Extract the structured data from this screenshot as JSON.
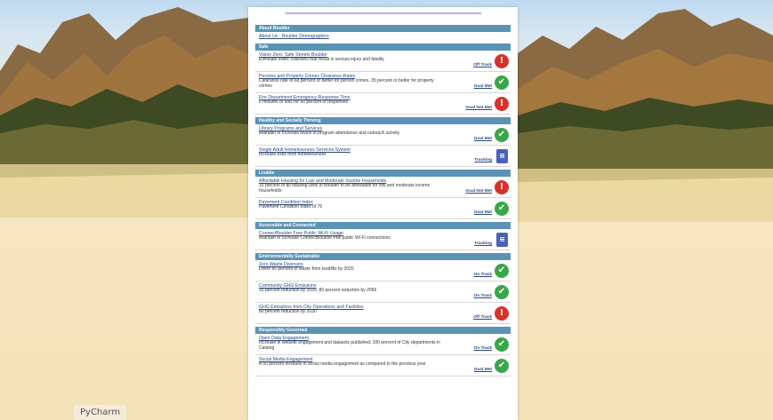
{
  "taskbar": {
    "app_label": "PyCharm"
  },
  "colors": {
    "section_header": "#5b93b6",
    "on_track": "#3aa64a",
    "off_track": "#d7322a",
    "tracking": "#4863b6"
  },
  "about": {
    "header": "About Boulder",
    "item_title": "About Us - Boulder Demographics"
  },
  "sections": [
    {
      "header": "Safe",
      "items": [
        {
          "title": "Vision Zero: Safe Streets Boulder",
          "desc": "Eliminate traffic collisions that result in serious injury and fatality",
          "status": "Off Track",
          "icon": "alert-icon"
        },
        {
          "title": "Persons and Property Crimes Clearance Rates",
          "desc": "Clearance rate of 68 percent or better for person crimes, 35 percent or better for property crimes",
          "status": "Goal Met",
          "icon": "check-icon"
        },
        {
          "title": "Fire Department Emergency Response Time",
          "desc": "6 minutes or less for 90 percent of responses",
          "status": "Goal Not Met",
          "icon": "alert-icon"
        }
      ]
    },
    {
      "header": "Healthy and Socially Thriving",
      "items": [
        {
          "title": "Library Programs and Services",
          "desc": "Maintain or increase levels of program attendance and outreach activity",
          "status": "Goal Met",
          "icon": "check-icon"
        },
        {
          "title": "Single Adult Homelessness Services System",
          "desc": "Increase exits from homelessness",
          "status": "Tracking",
          "icon": "clipboard-icon"
        }
      ]
    },
    {
      "header": "Livable",
      "items": [
        {
          "title": "Affordable Housing for Low and Moderate Income Households",
          "desc": "15 percent of all housing units in Boulder to be affordable for low and moderate income households",
          "status": "Goal Not Met",
          "icon": "alert-icon"
        },
        {
          "title": "Pavement Condition Index",
          "desc": "Pavement Condition Index of 75",
          "status": "Goal Met",
          "icon": "check-icon"
        }
      ]
    },
    {
      "header": "Accessible and Connected",
      "items": [
        {
          "title": "ConnectBoulder Free Public Wi-Fi Usage",
          "desc": "Maintain or increase ConnectBoulder free public Wi-Fi connections",
          "status": "Tracking",
          "icon": "clipboard-icon"
        }
      ]
    },
    {
      "header": "Environmentally Sustainable",
      "items": [
        {
          "title": "Zero Waste Diversion",
          "desc": "Divert 85 percent of waste from landfills by 2025",
          "status": "On Track",
          "icon": "check-icon"
        },
        {
          "title": "Community GHG Emissions",
          "desc": "15 percent reduction by 2020, 80 percent reduction by 2050",
          "status": "On Track",
          "icon": "check-icon"
        },
        {
          "title": "GHG Emissions from City Operations and Facilities",
          "desc": "80 percent reduction by 2030",
          "status": "Off Track",
          "icon": "alert-icon"
        }
      ]
    },
    {
      "header": "Responsibly Governed",
      "items": [
        {
          "title": "Open Data Engagement",
          "desc": "Increase in website engagement and datasets published; 100 percent of City departments in Catalog",
          "status": "On Track",
          "icon": "check-icon"
        },
        {
          "title": "Social Media Engagement",
          "desc": "A 50 percent increase in social media engagement as compared to the previous year",
          "status": "Goal Met",
          "icon": "check-icon"
        }
      ]
    }
  ]
}
